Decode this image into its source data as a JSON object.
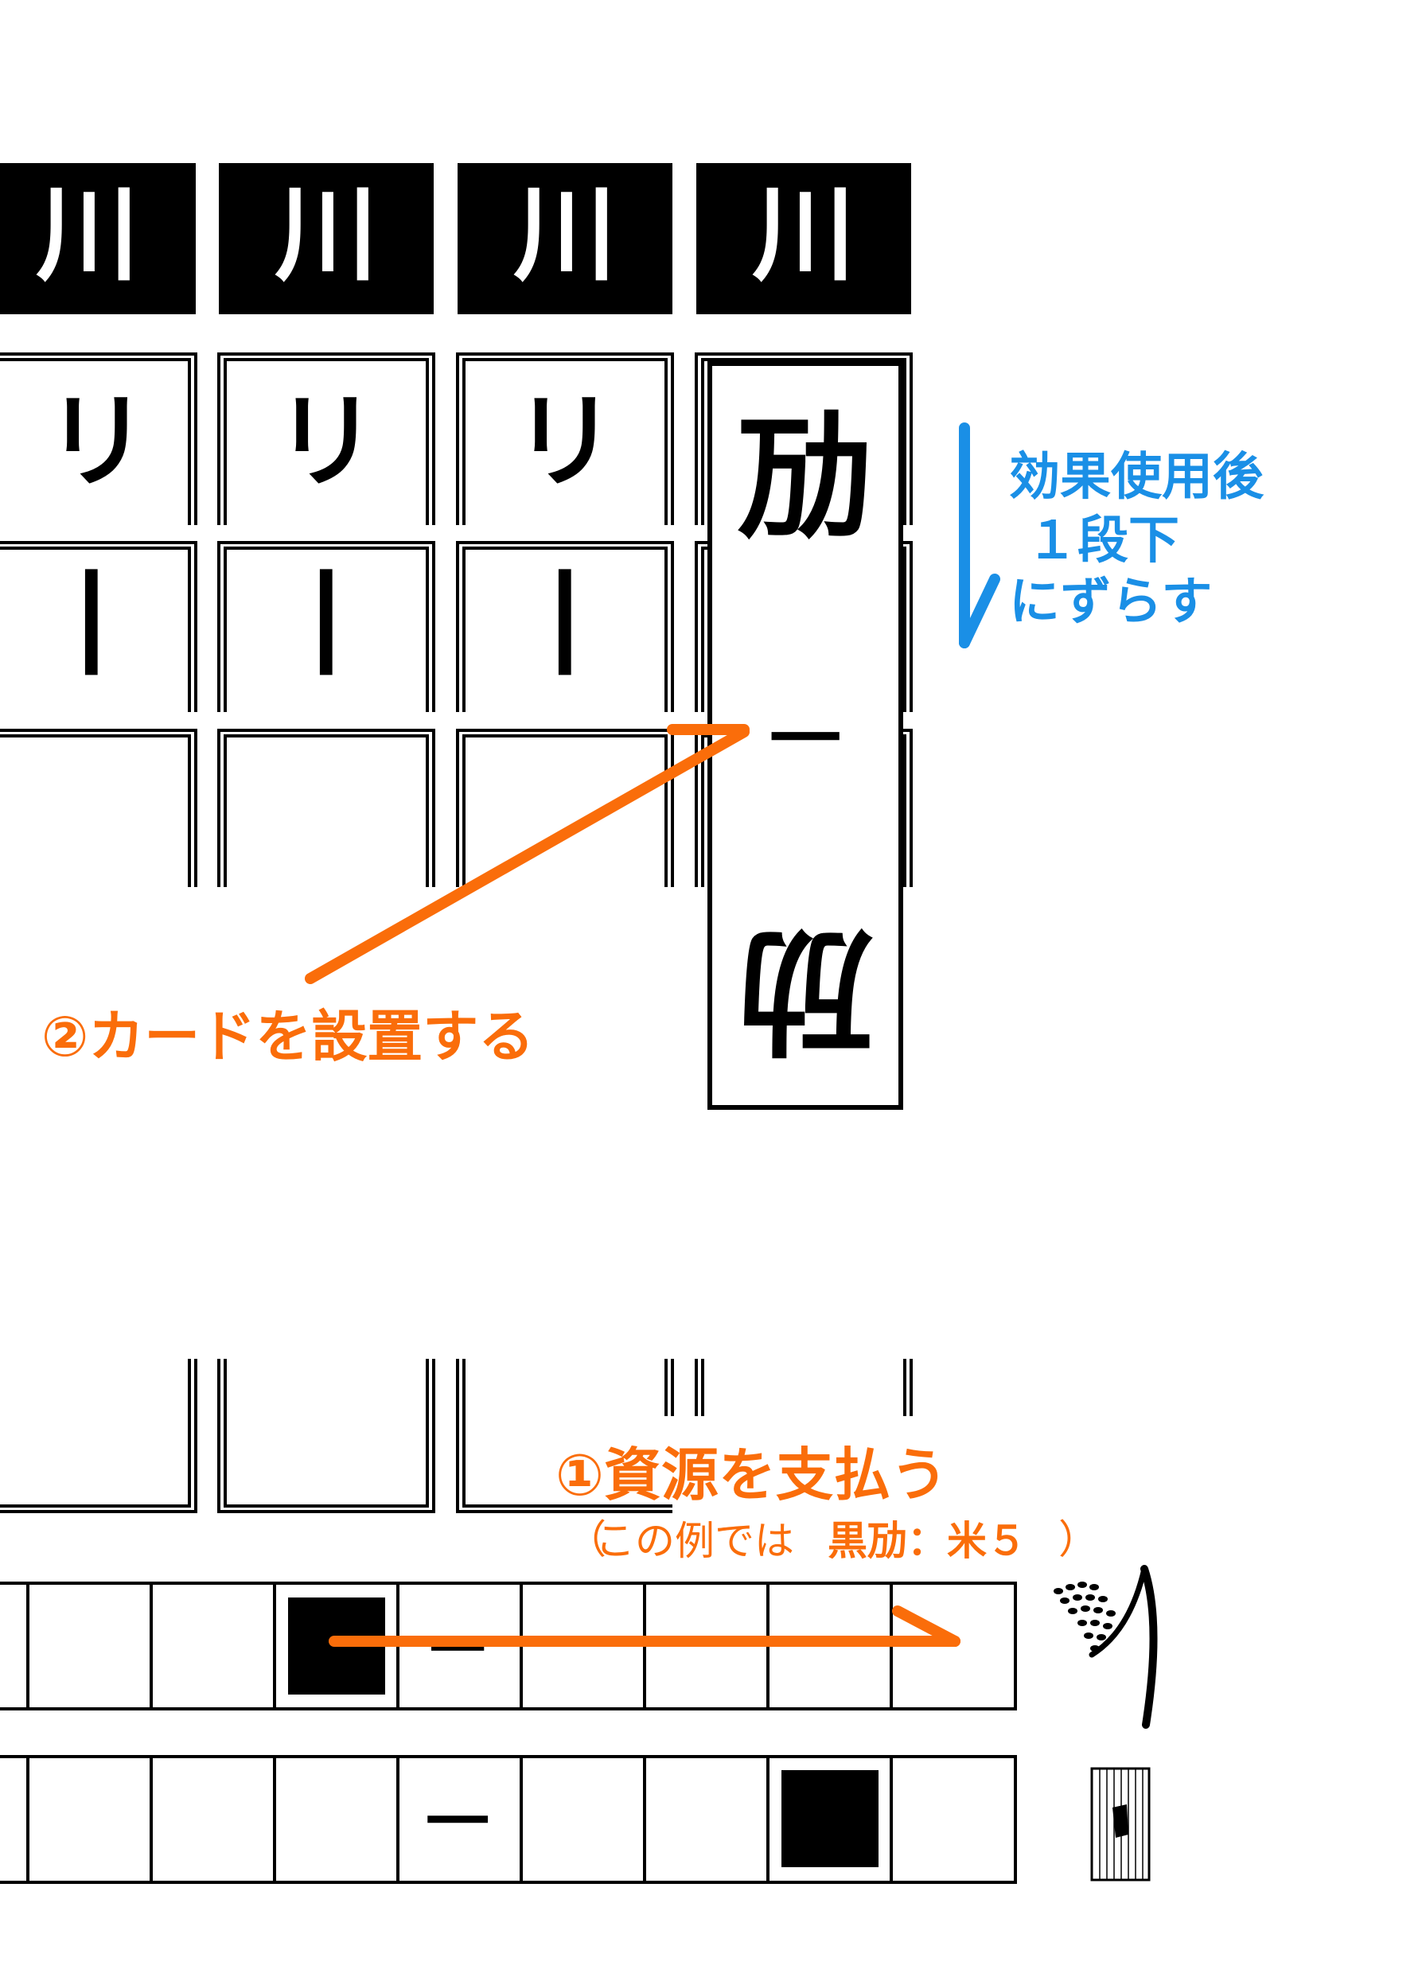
{
  "annotations": {
    "effect_line1": "効果使用後",
    "effect_line2": "１段下",
    "effect_line3": "にずらす",
    "step2": "②カードを設置する",
    "step1": "①資源を支払う",
    "example_open": "（",
    "example_text": "この例では",
    "example_cost": "黒劢：米５",
    "example_close": "）"
  },
  "board": {
    "top_row_glyph": "川",
    "second_row_glyph": "リ",
    "third_row_glyph": "丨"
  },
  "card": {
    "top_glyph": "劢",
    "middle_glyph": "一",
    "bottom_glyph": "劢"
  },
  "tracks": {
    "rice_track_marker": "一",
    "other_track_marker": "一"
  },
  "icons": {
    "rice": "rice-stalk-icon",
    "resource_tile": "striped-resource-tile-icon"
  },
  "colors": {
    "orange": "#fa6d0a",
    "blue": "#1a8fe6",
    "black": "#000000"
  }
}
